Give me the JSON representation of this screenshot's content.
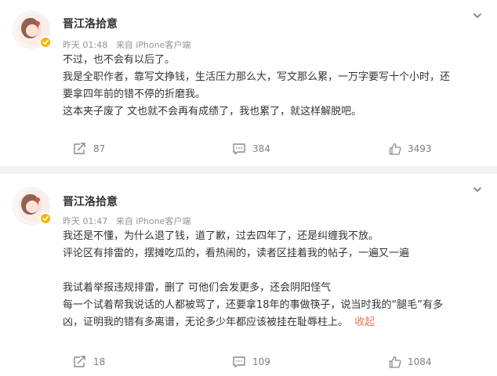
{
  "posts": [
    {
      "author": "晋江洛拾意",
      "time": "昨天 01:48",
      "source": "来自 iPhone客户端",
      "lines": [
        "不过，也不会有以后了。",
        "我是全职作者，靠写文挣钱，生活压力那么大，写文那么累，一万字要写十个小时，还",
        "要拿四年前的错不停的折磨我。",
        "这本夹子废了 文也就不会再有成绩了，我也累了，就这样解脱吧。"
      ],
      "reposts": "87",
      "comments": "384",
      "likes": "3493"
    },
    {
      "author": "晋江洛拾意",
      "time": "昨天 01:47",
      "source": "来自 iPhone客户端",
      "lines": [
        "我还是不懂，为什么退了钱，道了歉，过去四年了，还是纠缠我不放。",
        "评论区有排雷的，摆摊吃瓜的，看热闹的，读者区挂着我的帖子，一遍又一遍",
        "",
        "我试着举报违规排雷，删了 可他们会发更多，还会阴阳怪气",
        "每一个试着帮我说话的人都被骂了，还要拿18年的事做筷子，说当时我的“腿毛”有多",
        "凶，证明我的错有多离谱，无论多少年都应该被挂在耻辱柱上。"
      ],
      "collapse_label": "收起",
      "reposts": "18",
      "comments": "109",
      "likes": "1084"
    }
  ],
  "icons": {
    "more": "chevron-down-icon",
    "repost": "repost-icon",
    "comment": "comment-icon",
    "like": "thumbs-up-icon",
    "verified": "verified-badge-icon"
  },
  "colors": {
    "text": "#333333",
    "meta": "#939393",
    "action": "#808080",
    "collapse": "#eb7350",
    "badge": "#f7b500",
    "divider": "#f2f2f2"
  }
}
